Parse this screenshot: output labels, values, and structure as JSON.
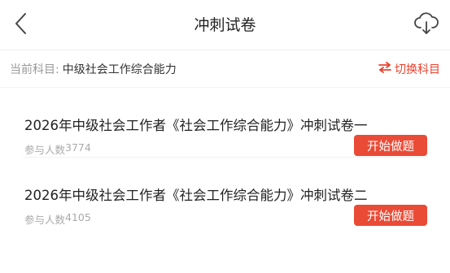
{
  "header": {
    "title": "冲刺试卷",
    "back_icon": "chevron-left-icon",
    "download_icon": "cloud-download-icon"
  },
  "subject": {
    "label": "当前科目:",
    "name": "中级社会工作综合能力",
    "switch_label": "切换科目",
    "switch_icon": "swap-arrows-icon",
    "accent": "#e8432e"
  },
  "exams": [
    {
      "title": "2026年中级社会工作者《社会工作综合能力》冲刺试卷一",
      "count_label": "参与人数",
      "count": "3774",
      "start_label": "开始做题"
    },
    {
      "title": "2026年中级社会工作者《社会工作综合能力》冲刺试卷二",
      "count_label": "参与人数",
      "count": "4105",
      "start_label": "开始做题"
    }
  ],
  "colors": {
    "button_bg": "#ea4b36",
    "muted_text": "#999999"
  }
}
